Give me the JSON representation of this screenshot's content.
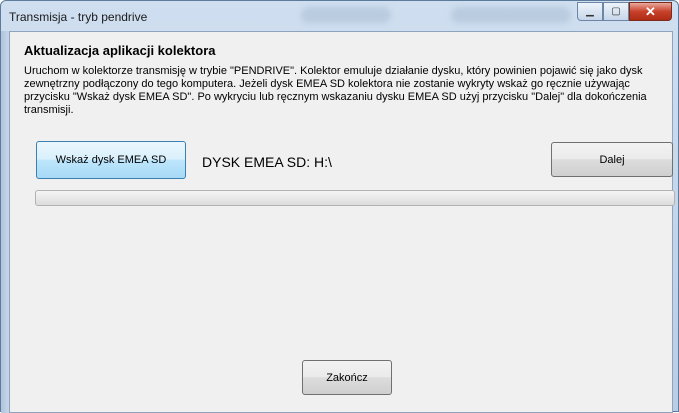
{
  "window": {
    "title": "Transmisja - tryb pendrive",
    "min_symbol": "▁",
    "max_symbol": "▢",
    "close_symbol": "✕"
  },
  "main": {
    "heading": "Aktualizacja aplikacji kolektora",
    "description": "Uruchom w kolektorze transmisję w trybie \"PENDRIVE\". Kolektor emuluje działanie dysku, który powinien pojawić się jako dysk zewnętrzny podłączony do tego komputera.  Jeżeli dysk EMEA SD kolektora nie zostanie wykryty wskaż go ręcznie używając przycisku \"Wskaż dysk EMEA SD\". Po wykryciu lub ręcznym wskazaniu dysku EMEA SD użyj przycisku \"Dalej\" dla dokończenia transmisji.",
    "select_disk_button": "Wskaż dysk EMEA SD",
    "disk_label": "DYSK EMEA SD:  H:\\",
    "next_button": "Dalej",
    "progress_value": 0,
    "finish_button": "Zakończ"
  },
  "colors": {
    "progress_fill": "#06b025",
    "close_button": "#c8412a"
  }
}
